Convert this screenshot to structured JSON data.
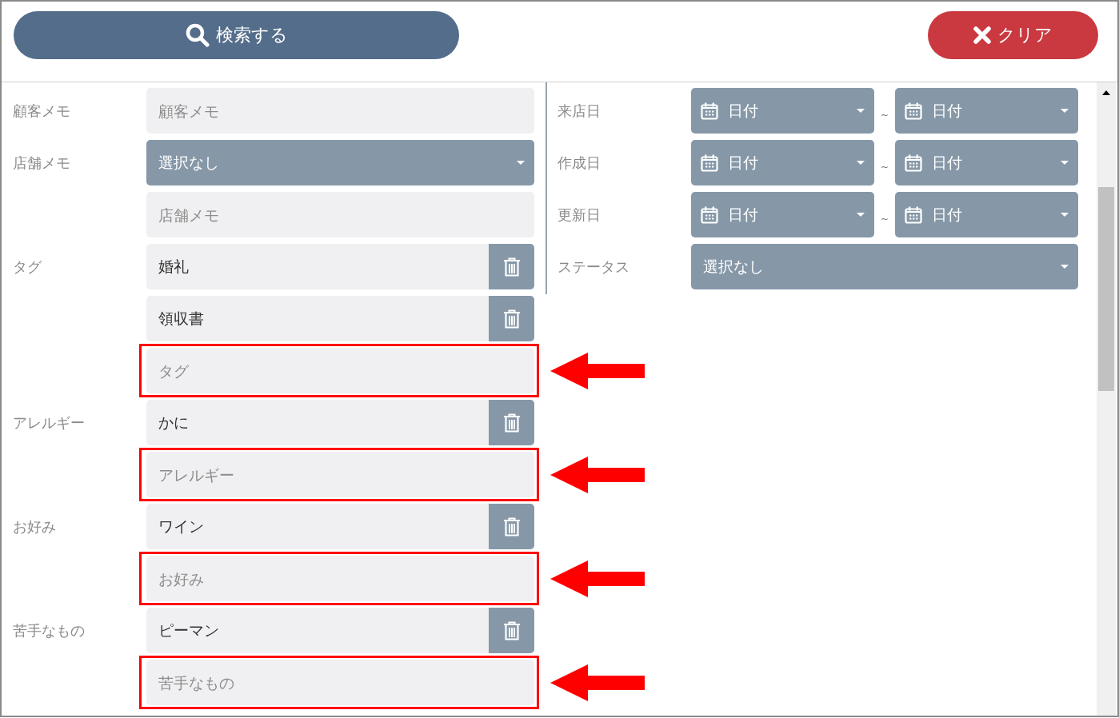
{
  "toolbar": {
    "search_button": {
      "label": "検索する"
    },
    "clear_button": {
      "label": "クリア"
    }
  },
  "left_groups": [
    {
      "label": "顧客メモ",
      "items": [
        {
          "kind": "text",
          "placeholder": "顧客メモ",
          "highlighted": false
        }
      ]
    },
    {
      "label": "店舗メモ",
      "items": [
        {
          "kind": "select",
          "value": "選択なし",
          "highlighted": false
        },
        {
          "kind": "text",
          "placeholder": "店舗メモ",
          "highlighted": false
        }
      ]
    },
    {
      "label": "タグ",
      "items": [
        {
          "kind": "tag",
          "value": "婚礼",
          "highlighted": false
        },
        {
          "kind": "tag",
          "value": "領収書",
          "highlighted": false
        },
        {
          "kind": "text",
          "placeholder": "タグ",
          "highlighted": true
        }
      ]
    },
    {
      "label": "アレルギー",
      "items": [
        {
          "kind": "tag",
          "value": "かに",
          "highlighted": false
        },
        {
          "kind": "text",
          "placeholder": "アレルギー",
          "highlighted": true
        }
      ]
    },
    {
      "label": "お好み",
      "items": [
        {
          "kind": "tag",
          "value": "ワイン",
          "highlighted": false
        },
        {
          "kind": "text",
          "placeholder": "お好み",
          "highlighted": true
        }
      ]
    },
    {
      "label": "苦手なもの",
      "items": [
        {
          "kind": "tag",
          "value": "ピーマン",
          "highlighted": false
        },
        {
          "kind": "text",
          "placeholder": "苦手なもの",
          "highlighted": true
        }
      ]
    }
  ],
  "right_rows": [
    {
      "label": "来店日",
      "kind": "date_range",
      "from": "日付",
      "separator": "~",
      "to": "日付"
    },
    {
      "label": "作成日",
      "kind": "date_range",
      "from": "日付",
      "separator": "~",
      "to": "日付"
    },
    {
      "label": "更新日",
      "kind": "date_range",
      "from": "日付",
      "separator": "~",
      "to": "日付"
    },
    {
      "label": "ステータス",
      "kind": "select",
      "value": "選択なし"
    }
  ]
}
